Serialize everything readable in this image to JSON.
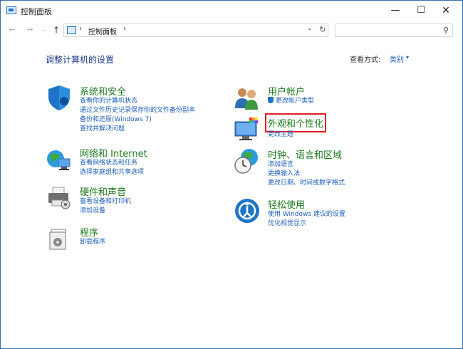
{
  "window": {
    "title": "控制面板",
    "minimize": "—",
    "maximize": "☐",
    "close": "✕"
  },
  "address": {
    "back": "←",
    "forward": "→",
    "recent": "⌄",
    "up": "↑",
    "separator": "›",
    "crumb": "控制面板",
    "dropdown": "⌄",
    "refresh": "↻",
    "search_icon": "⚲"
  },
  "header": {
    "title": "调整计算机的设置",
    "view_by_label": "查看方式:",
    "view_by_value": "类别",
    "caret": "▾"
  },
  "categories": [
    {
      "id": "security",
      "title": "系统和安全",
      "icon": "shield-icon",
      "links": [
        "查看你的计算机状态",
        "通过文件历史记录保存你的文件备份副本",
        "备份和还原(Windows 7)",
        "查找并解决问题"
      ]
    },
    {
      "id": "network",
      "title": "网络和 Internet",
      "icon": "network-globe-icon",
      "links": [
        "查看网络状态和任务",
        "选择家庭组和共享选项"
      ]
    },
    {
      "id": "hardware",
      "title": "硬件和声音",
      "icon": "printer-icon",
      "links": [
        "查看设备和打印机",
        "添加设备"
      ]
    },
    {
      "id": "programs",
      "title": "程序",
      "icon": "programs-icon",
      "links": [
        "卸载程序"
      ]
    },
    {
      "id": "users",
      "title": "用户帐户",
      "icon": "users-icon",
      "links": [
        "更改帐户类型"
      ]
    },
    {
      "id": "appearance",
      "title": "外观和个性化",
      "icon": "appearance-monitor-icon",
      "links": [
        "更改主题"
      ]
    },
    {
      "id": "clock",
      "title": "时钟、语言和区域",
      "icon": "clock-globe-icon",
      "links": [
        "添加语言",
        "更换输入法",
        "更改日期、时间或数字格式"
      ]
    },
    {
      "id": "ease",
      "title": "轻松使用",
      "icon": "ease-of-access-icon",
      "links": [
        "使用 Windows 建议的设置",
        "优化视觉显示"
      ]
    }
  ],
  "colors": {
    "category_title": "#1d7a1d",
    "link": "#1c5fbf",
    "highlight_box": "#e02020",
    "page_title": "#1e3e8a"
  }
}
